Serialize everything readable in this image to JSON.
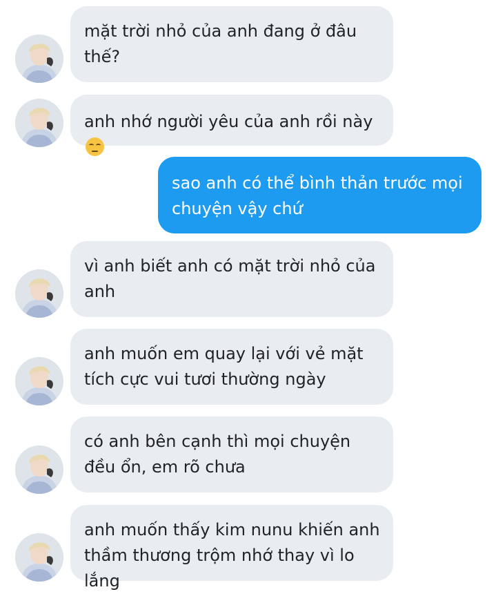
{
  "messages": [
    {
      "side": "in",
      "text": "mặt trời nhỏ của anh đang ở đâu thế?"
    },
    {
      "side": "in",
      "text": "anh nhớ người yêu của anh rồi này",
      "emoji": "pensive-face-emoji"
    },
    {
      "side": "out",
      "text": "sao anh có thể bình thản trước mọi chuyện vậy chứ"
    },
    {
      "side": "in",
      "text": "vì anh biết anh có mặt trời nhỏ của anh"
    },
    {
      "side": "in",
      "text": "anh muốn em quay lại với vẻ mặt tích cực vui tươi thường ngày"
    },
    {
      "side": "in",
      "text": "có anh bên cạnh thì mọi chuyện đều ổn, em rõ chưa"
    },
    {
      "side": "in",
      "text": "anh muốn thấy kim nunu khiến anh thầm thương trộm nhớ thay vì lo lắng"
    }
  ],
  "colors": {
    "incoming_bubble": "#e9ecf1",
    "outgoing_bubble": "#1d9bf0",
    "incoming_text": "#1f2226",
    "outgoing_text": "#ffffff"
  }
}
